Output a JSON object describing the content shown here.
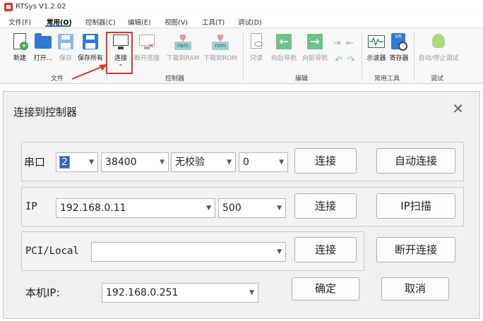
{
  "app": {
    "title": "RTSys V1.2.02",
    "menu": [
      "文件(F)",
      "常用(O)",
      "控制器(C)",
      "编辑(E)",
      "视图(V)",
      "工具(T)",
      "调试(D)"
    ]
  },
  "ribbon": {
    "file_group": {
      "label": "文件",
      "buttons": [
        "新建",
        "打开...",
        "保存",
        "保存所有"
      ]
    },
    "controller_group": {
      "label": "控制器",
      "buttons": [
        "连接",
        "断开连接",
        "下载到RAM",
        "下载到ROM"
      ],
      "ram_tag": "ram",
      "rom_tag": "rom"
    },
    "edit_group": {
      "label": "编辑",
      "buttons": [
        "只读",
        "向后导航",
        "向前导航"
      ]
    },
    "tools_group": {
      "label": "常用工具",
      "buttons": [
        "示波器",
        "寄存器"
      ]
    },
    "debug_group": {
      "label": "调试",
      "buttons": [
        "自动/停止调试"
      ]
    },
    "dropdown_caret": "⌄",
    "highlight_color": "#d8362e"
  },
  "dialog": {
    "title": "连接到控制器",
    "close_glyph": "✕",
    "serial": {
      "label": "串口",
      "port": "2",
      "baud": "38400",
      "parity": "无校验",
      "extra": "0",
      "connect_button": "连接",
      "auto_connect_button": "自动连接"
    },
    "ip": {
      "label": "IP",
      "address": "192.168.0.11",
      "port": "500",
      "connect_button": "连接",
      "scan_button": "IP扫描"
    },
    "pci": {
      "label": "PCI/Local",
      "value": "",
      "connect_button": "连接",
      "disconnect_button": "断开连接"
    },
    "local_ip": {
      "label": "本机IP:",
      "value": "192.168.0.251"
    },
    "ok_button": "确定",
    "cancel_button": "取消"
  }
}
